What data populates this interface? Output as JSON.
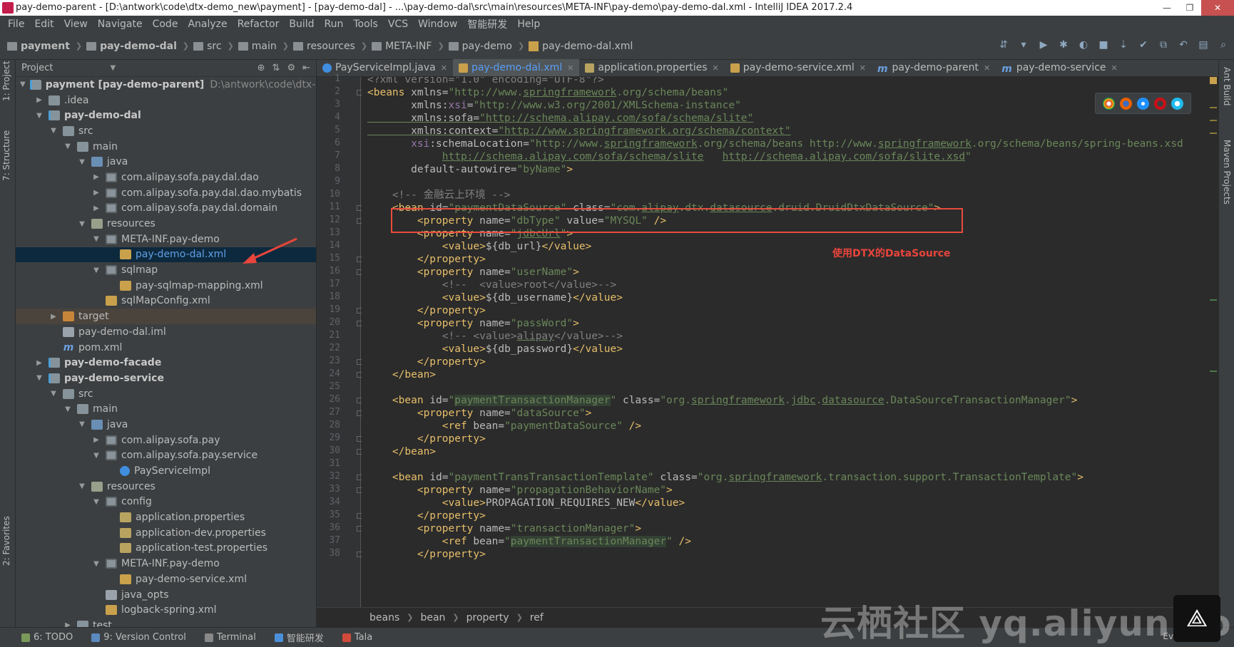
{
  "window": {
    "title": "pay-demo-parent - [D:\\antwork\\code\\dtx-demo_new\\payment] - [pay-demo-dal] - ...\\pay-demo-dal\\src\\main\\resources\\META-INF\\pay-demo\\pay-demo-dal.xml - IntelliJ IDEA 2017.2.4"
  },
  "menu": [
    "File",
    "Edit",
    "View",
    "Navigate",
    "Code",
    "Analyze",
    "Refactor",
    "Build",
    "Run",
    "Tools",
    "VCS",
    "Window",
    "智能研发",
    "Help"
  ],
  "breadcrumbs": [
    "payment",
    "pay-demo-dal",
    "src",
    "main",
    "resources",
    "META-INF",
    "pay-demo",
    "pay-demo-dal.xml"
  ],
  "sidebar": {
    "left_tabs": [
      "1: Project",
      "7: Structure",
      "2: Favorites"
    ],
    "right_tabs": [
      "Ant Build",
      "Maven Projects"
    ]
  },
  "project": {
    "header": "Project",
    "tree": [
      {
        "label": "payment [pay-demo-parent]",
        "path": "D:\\antwork\\code\\dtx-dem",
        "depth": 0,
        "toggle": "▼",
        "icon": "module",
        "bold": true
      },
      {
        "label": ".idea",
        "depth": 1,
        "toggle": "▶",
        "icon": "folder"
      },
      {
        "label": "pay-demo-dal",
        "depth": 1,
        "toggle": "▼",
        "icon": "module",
        "bold": true
      },
      {
        "label": "src",
        "depth": 2,
        "toggle": "▼",
        "icon": "folder"
      },
      {
        "label": "main",
        "depth": 3,
        "toggle": "▼",
        "icon": "folder"
      },
      {
        "label": "java",
        "depth": 4,
        "toggle": "▼",
        "icon": "src"
      },
      {
        "label": "com.alipay.sofa.pay.dal.dao",
        "depth": 5,
        "toggle": "▶",
        "icon": "pkg"
      },
      {
        "label": "com.alipay.sofa.pay.dal.dao.mybatis",
        "depth": 5,
        "toggle": "▶",
        "icon": "pkg"
      },
      {
        "label": "com.alipay.sofa.pay.dal.domain",
        "depth": 5,
        "toggle": "▶",
        "icon": "pkg"
      },
      {
        "label": "resources",
        "depth": 4,
        "toggle": "▼",
        "icon": "res"
      },
      {
        "label": "META-INF.pay-demo",
        "depth": 5,
        "toggle": "▼",
        "icon": "pkg"
      },
      {
        "label": "pay-demo-dal.xml",
        "depth": 6,
        "toggle": "",
        "icon": "xml",
        "selected": true
      },
      {
        "label": "sqlmap",
        "depth": 5,
        "toggle": "▼",
        "icon": "pkg"
      },
      {
        "label": "pay-sqlmap-mapping.xml",
        "depth": 6,
        "toggle": "",
        "icon": "xml"
      },
      {
        "label": "sqlMapConfig.xml",
        "depth": 5,
        "toggle": "",
        "icon": "xml"
      },
      {
        "label": "target",
        "depth": 2,
        "toggle": "▶",
        "icon": "target",
        "target": true
      },
      {
        "label": "pay-demo-dal.iml",
        "depth": 2,
        "toggle": "",
        "icon": "file"
      },
      {
        "label": "pom.xml",
        "depth": 2,
        "toggle": "",
        "icon": "m"
      },
      {
        "label": "pay-demo-facade",
        "depth": 1,
        "toggle": "▶",
        "icon": "module",
        "bold": true
      },
      {
        "label": "pay-demo-service",
        "depth": 1,
        "toggle": "▼",
        "icon": "module",
        "bold": true
      },
      {
        "label": "src",
        "depth": 2,
        "toggle": "▼",
        "icon": "folder"
      },
      {
        "label": "main",
        "depth": 3,
        "toggle": "▼",
        "icon": "folder"
      },
      {
        "label": "java",
        "depth": 4,
        "toggle": "▼",
        "icon": "src"
      },
      {
        "label": "com.alipay.sofa.pay",
        "depth": 5,
        "toggle": "▶",
        "icon": "pkg"
      },
      {
        "label": "com.alipay.sofa.pay.service",
        "depth": 5,
        "toggle": "▼",
        "icon": "pkg"
      },
      {
        "label": "PayServiceImpl",
        "depth": 6,
        "toggle": "",
        "icon": "cls"
      },
      {
        "label": "resources",
        "depth": 4,
        "toggle": "▼",
        "icon": "res"
      },
      {
        "label": "config",
        "depth": 5,
        "toggle": "▼",
        "icon": "pkg"
      },
      {
        "label": "application.properties",
        "depth": 6,
        "toggle": "",
        "icon": "props"
      },
      {
        "label": "application-dev.properties",
        "depth": 6,
        "toggle": "",
        "icon": "props"
      },
      {
        "label": "application-test.properties",
        "depth": 6,
        "toggle": "",
        "icon": "props"
      },
      {
        "label": "META-INF.pay-demo",
        "depth": 5,
        "toggle": "▼",
        "icon": "pkg"
      },
      {
        "label": "pay-demo-service.xml",
        "depth": 6,
        "toggle": "",
        "icon": "xml"
      },
      {
        "label": "java_opts",
        "depth": 5,
        "toggle": "",
        "icon": "file"
      },
      {
        "label": "logback-spring.xml",
        "depth": 5,
        "toggle": "",
        "icon": "xml"
      },
      {
        "label": "test",
        "depth": 3,
        "toggle": "▶",
        "icon": "folder"
      }
    ]
  },
  "tabs": [
    {
      "label": "PayServiceImpl.java",
      "icon": "c"
    },
    {
      "label": "pay-demo-dal.xml",
      "icon": "x",
      "active": true
    },
    {
      "label": "application.properties",
      "icon": "p"
    },
    {
      "label": "pay-demo-service.xml",
      "icon": "x"
    },
    {
      "label": "pay-demo-parent",
      "icon": "mm"
    },
    {
      "label": "pay-demo-service",
      "icon": "mm"
    }
  ],
  "code_lines": [
    [
      [
        "<?xml version=\"1.0\" encoding=\"UTF-8\"?>",
        "c",
        ""
      ]
    ],
    [
      [
        "<beans ",
        "t",
        ""
      ],
      [
        "xmlns=",
        "a",
        ""
      ],
      [
        "\"http://www.",
        "s",
        ""
      ],
      [
        "springframework",
        "s",
        "u"
      ],
      [
        ".org/schema/beans\"",
        "s",
        ""
      ]
    ],
    [
      [
        "       xmlns:",
        "a",
        ""
      ],
      [
        "xsi",
        "ns",
        ""
      ],
      [
        "=",
        "a",
        ""
      ],
      [
        "\"http://www.w3.org/2001/XMLSchema-instance\"",
        "s",
        ""
      ]
    ],
    [
      [
        "       xmlns:sofa=",
        "a",
        "u"
      ],
      [
        "\"http://schema.alipay.com/sofa/schema/slite\"",
        "s",
        "u"
      ]
    ],
    [
      [
        "       xmlns:context=",
        "a",
        "u"
      ],
      [
        "\"http://www.springframework.org/schema/context\"",
        "s",
        "u"
      ]
    ],
    [
      [
        "       ",
        "a",
        ""
      ],
      [
        "xsi",
        "ns",
        ""
      ],
      [
        ":schemaLocation=",
        "a",
        ""
      ],
      [
        "\"http://www.",
        "s",
        ""
      ],
      [
        "springframework",
        "s",
        "u"
      ],
      [
        ".org/schema/beans http://www.",
        "s",
        ""
      ],
      [
        "springframework",
        "s",
        "u"
      ],
      [
        ".org/schema/beans/spring-beans.xsd",
        "s",
        ""
      ]
    ],
    [
      [
        "            ",
        "a",
        ""
      ],
      [
        "http://schema.alipay.com/sofa/schema/slite",
        "s",
        "u"
      ],
      [
        "   ",
        "s",
        ""
      ],
      [
        "http://schema.alipay.com/sofa/slite.xsd",
        "s",
        "u"
      ],
      [
        "\"",
        "s",
        ""
      ]
    ],
    [
      [
        "       default-autowire=",
        "a",
        ""
      ],
      [
        "\"byName\"",
        "s",
        ""
      ],
      [
        ">",
        "t",
        ""
      ]
    ],
    [
      [
        "",
        "a",
        ""
      ]
    ],
    [
      [
        "    <!-- 金融云上环境 -->",
        "c",
        ""
      ]
    ],
    [
      [
        "    <bean ",
        "t",
        ""
      ],
      [
        "id=",
        "a",
        ""
      ],
      [
        "\"paymentDataSource\"",
        "s",
        ""
      ],
      [
        " class=",
        "a",
        ""
      ],
      [
        "\"com.",
        "s",
        ""
      ],
      [
        "alipay",
        "s",
        "u"
      ],
      [
        ".dtx.",
        "s",
        ""
      ],
      [
        "datasource",
        "s",
        "u"
      ],
      [
        ".druid.DruidDtxDataSource\"",
        "s",
        ""
      ],
      [
        ">",
        "t",
        ""
      ]
    ],
    [
      [
        "        <property ",
        "t",
        ""
      ],
      [
        "name=",
        "a",
        ""
      ],
      [
        "\"dbType\"",
        "s",
        ""
      ],
      [
        " value=",
        "a",
        ""
      ],
      [
        "\"MYSQL\"",
        "s",
        ""
      ],
      [
        " />",
        "t",
        ""
      ]
    ],
    [
      [
        "        <property ",
        "t",
        ""
      ],
      [
        "name=",
        "a",
        ""
      ],
      [
        "\"",
        "s",
        ""
      ],
      [
        "jdbcUrl",
        "s",
        "u"
      ],
      [
        "\"",
        "s",
        ""
      ],
      [
        ">",
        "t",
        ""
      ]
    ],
    [
      [
        "            <value>",
        "t",
        ""
      ],
      [
        "${db_url}",
        "a",
        ""
      ],
      [
        "</value>",
        "t",
        ""
      ]
    ],
    [
      [
        "        </property>",
        "t",
        ""
      ]
    ],
    [
      [
        "        <property ",
        "t",
        ""
      ],
      [
        "name=",
        "a",
        ""
      ],
      [
        "\"userName\"",
        "s",
        ""
      ],
      [
        ">",
        "t",
        ""
      ]
    ],
    [
      [
        "            <!--  <value>root</value>-->",
        "c",
        ""
      ]
    ],
    [
      [
        "            <value>",
        "t",
        ""
      ],
      [
        "${db_username}",
        "a",
        ""
      ],
      [
        "</value>",
        "t",
        ""
      ]
    ],
    [
      [
        "        </property>",
        "t",
        ""
      ]
    ],
    [
      [
        "        <property ",
        "t",
        ""
      ],
      [
        "name=",
        "a",
        ""
      ],
      [
        "\"passWord\"",
        "s",
        ""
      ],
      [
        ">",
        "t",
        ""
      ]
    ],
    [
      [
        "            <!-- <value>",
        "c",
        ""
      ],
      [
        "alipay",
        "c",
        "u"
      ],
      [
        "</value>-->",
        "c",
        ""
      ]
    ],
    [
      [
        "            <value>",
        "t",
        ""
      ],
      [
        "${db_password}",
        "a",
        ""
      ],
      [
        "</value>",
        "t",
        ""
      ]
    ],
    [
      [
        "        </property>",
        "t",
        ""
      ]
    ],
    [
      [
        "    </bean>",
        "t",
        ""
      ]
    ],
    [
      [
        "",
        "a",
        ""
      ]
    ],
    [
      [
        "    <bean ",
        "t",
        ""
      ],
      [
        "id=",
        "a",
        ""
      ],
      [
        "\"",
        "s",
        ""
      ],
      [
        "paymentTransactionManager",
        "s",
        "hl"
      ],
      [
        "\"",
        "s",
        ""
      ],
      [
        " class=",
        "a",
        ""
      ],
      [
        "\"org.",
        "s",
        ""
      ],
      [
        "springframework",
        "s",
        "u"
      ],
      [
        ".",
        "s",
        ""
      ],
      [
        "jdbc",
        "s",
        "u"
      ],
      [
        ".",
        "s",
        ""
      ],
      [
        "datasource",
        "s",
        "u"
      ],
      [
        ".DataSourceTransactionManager\"",
        "s",
        ""
      ],
      [
        ">",
        "t",
        ""
      ]
    ],
    [
      [
        "        <property ",
        "t",
        ""
      ],
      [
        "name=",
        "a",
        ""
      ],
      [
        "\"dataSource\"",
        "s",
        ""
      ],
      [
        ">",
        "t",
        ""
      ]
    ],
    [
      [
        "            <ref ",
        "t",
        ""
      ],
      [
        "bean=",
        "a",
        ""
      ],
      [
        "\"paymentDataSource\"",
        "s",
        ""
      ],
      [
        " />",
        "t",
        ""
      ]
    ],
    [
      [
        "        </property>",
        "t",
        ""
      ]
    ],
    [
      [
        "    </bean>",
        "t",
        ""
      ]
    ],
    [
      [
        "",
        "a",
        ""
      ]
    ],
    [
      [
        "    <bean ",
        "t",
        ""
      ],
      [
        "id=",
        "a",
        ""
      ],
      [
        "\"paymentTransTransactionTemplate\"",
        "s",
        ""
      ],
      [
        " class=",
        "a",
        ""
      ],
      [
        "\"org.",
        "s",
        ""
      ],
      [
        "springframework",
        "s",
        "u"
      ],
      [
        ".transaction.support.TransactionTemplate\"",
        "s",
        ""
      ],
      [
        ">",
        "t",
        ""
      ]
    ],
    [
      [
        "        <property ",
        "t",
        ""
      ],
      [
        "name=",
        "a",
        ""
      ],
      [
        "\"propagationBehaviorName\"",
        "s",
        ""
      ],
      [
        ">",
        "t",
        ""
      ]
    ],
    [
      [
        "            <value>",
        "t",
        ""
      ],
      [
        "PROPAGATION_REQUIRES_NEW",
        "a",
        ""
      ],
      [
        "</value>",
        "t",
        ""
      ]
    ],
    [
      [
        "        </property>",
        "t",
        ""
      ]
    ],
    [
      [
        "        <property ",
        "t",
        ""
      ],
      [
        "name=",
        "a",
        ""
      ],
      [
        "\"transactionManager\"",
        "s",
        ""
      ],
      [
        ">",
        "t",
        ""
      ]
    ],
    [
      [
        "            <ref ",
        "t",
        ""
      ],
      [
        "bean=",
        "a",
        ""
      ],
      [
        "\"",
        "s",
        ""
      ],
      [
        "paymentTransactionManager",
        "s",
        "hl"
      ],
      [
        "\"",
        "s",
        ""
      ],
      [
        " />",
        "t",
        ""
      ]
    ],
    [
      [
        "        </property>",
        "t",
        ""
      ]
    ]
  ],
  "annotation": "使用DTX的DataSource",
  "editor_breadcrumbs": [
    "beans",
    "bean",
    "property",
    "ref"
  ],
  "status": [
    {
      "label": "6: TODO",
      "color": "#7a9a5a"
    },
    {
      "label": "9: Version Control",
      "color": "#5a8ac0"
    },
    {
      "label": "Terminal",
      "color": "#888888"
    },
    {
      "label": "智能研发",
      "color": "#4a90d9"
    },
    {
      "label": "Tala",
      "color": "#d04a3a"
    }
  ],
  "event_log": "Event Log",
  "watermark": "云栖社区 yq.aliyun.com",
  "colors": {
    "tag": "#e8bf6a",
    "attr": "#bababa",
    "string": "#6a8759",
    "comment": "#808080",
    "annotation": "#e8453c"
  }
}
